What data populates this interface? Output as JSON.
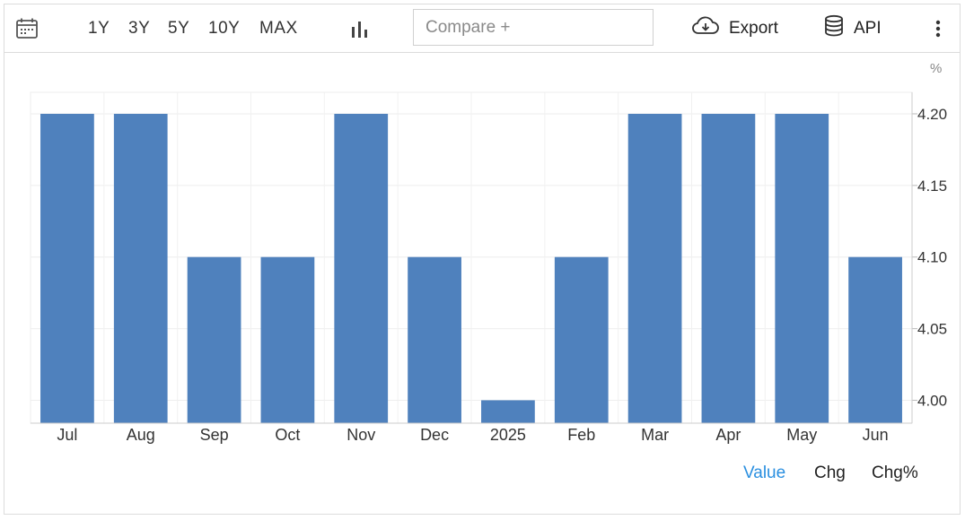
{
  "toolbar": {
    "calendar_icon": "calendar-icon",
    "ranges": [
      "1Y",
      "3Y",
      "5Y",
      "10Y",
      "MAX"
    ],
    "chart_type_icon": "bar-chart-icon",
    "compare_placeholder": "Compare +",
    "export_label": "Export",
    "export_icon": "cloud-download-icon",
    "api_label": "API",
    "api_icon": "database-icon",
    "more_icon": "more-vertical-icon"
  },
  "chart_data": {
    "type": "bar",
    "unit": "%",
    "categories": [
      "Jul",
      "Aug",
      "Sep",
      "Oct",
      "Nov",
      "Dec",
      "2025",
      "Feb",
      "Mar",
      "Apr",
      "May",
      "Jun"
    ],
    "values": [
      4.2,
      4.2,
      4.1,
      4.1,
      4.2,
      4.1,
      4.0,
      4.1,
      4.2,
      4.2,
      4.2,
      4.1
    ],
    "yticks": [
      "4.00",
      "4.05",
      "4.10",
      "4.15",
      "4.20"
    ],
    "ylim": [
      3.984,
      4.215
    ],
    "grid": true,
    "bar_color": "#4f81bd"
  },
  "view_tabs": {
    "value": "Value",
    "chg": "Chg",
    "chg_pct": "Chg%",
    "active_color": "#2a8fe0"
  }
}
